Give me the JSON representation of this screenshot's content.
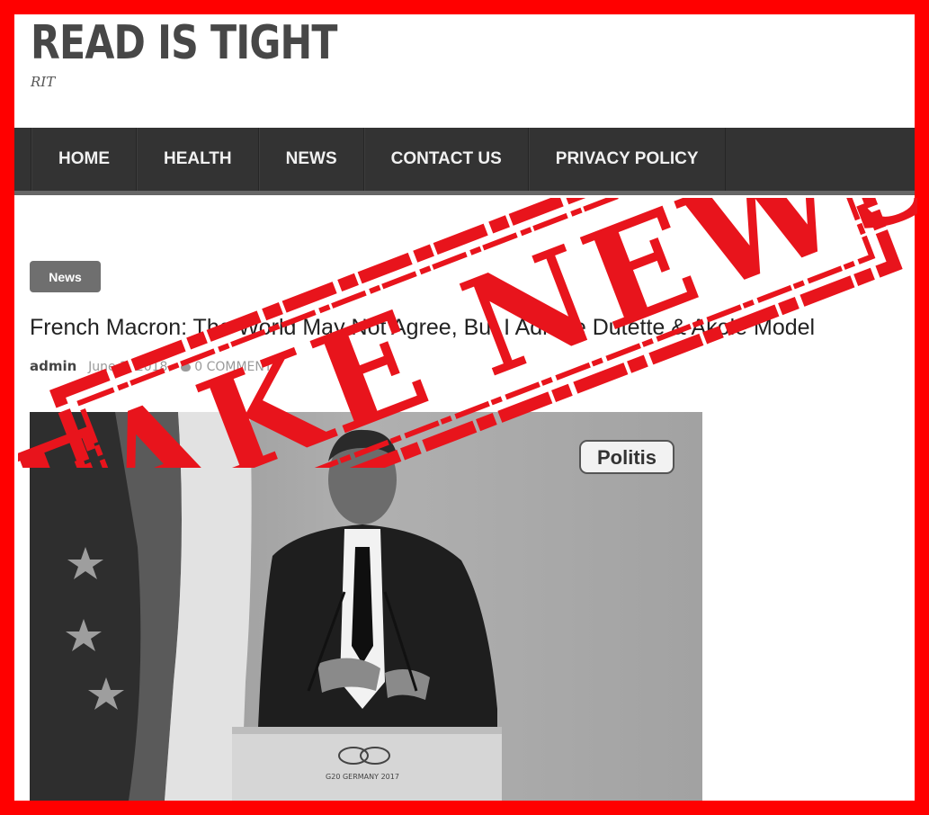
{
  "site": {
    "title": "READ IS TIGHT",
    "tagline": "RIT"
  },
  "nav": {
    "items": [
      {
        "label": "HOME"
      },
      {
        "label": "HEALTH"
      },
      {
        "label": "NEWS"
      },
      {
        "label": "CONTACT US"
      },
      {
        "label": "PRIVACY POLICY"
      }
    ]
  },
  "post": {
    "category": "News",
    "title": "French Macron: The World May Not Agree, But I Admire Dutette & Akole Model",
    "author": "admin",
    "date": "June 3, 2018",
    "comments": "0 COMMENTS"
  },
  "photo": {
    "watermark": "Politis",
    "podium_text": "G20 GERMANY 2017"
  },
  "stamp": {
    "text": "FAKE NEWS",
    "color": "#e8141c"
  },
  "colors": {
    "border": "#ff0000",
    "nav_bg": "#333333",
    "badge_bg": "#6f6f6f"
  }
}
